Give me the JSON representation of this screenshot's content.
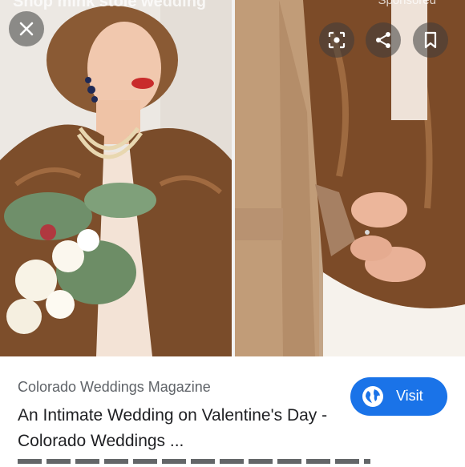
{
  "viewer": {
    "faded_title": "Shop mink stole wedding",
    "faded_sponsored": "Sponsored",
    "close_button": "close-icon",
    "lens_button": "lens-icon",
    "share_button": "share-icon",
    "save_button": "bookmark-icon"
  },
  "result": {
    "source": "Colorado Weddings Magazine",
    "title": "An Intimate Wedding on Valentine's Day - Colorado Weddings ...",
    "visit_label": "Visit",
    "visit_icon": "globe-icon"
  },
  "colors": {
    "accent": "#1a73e8",
    "fur": "#8a5a33"
  }
}
